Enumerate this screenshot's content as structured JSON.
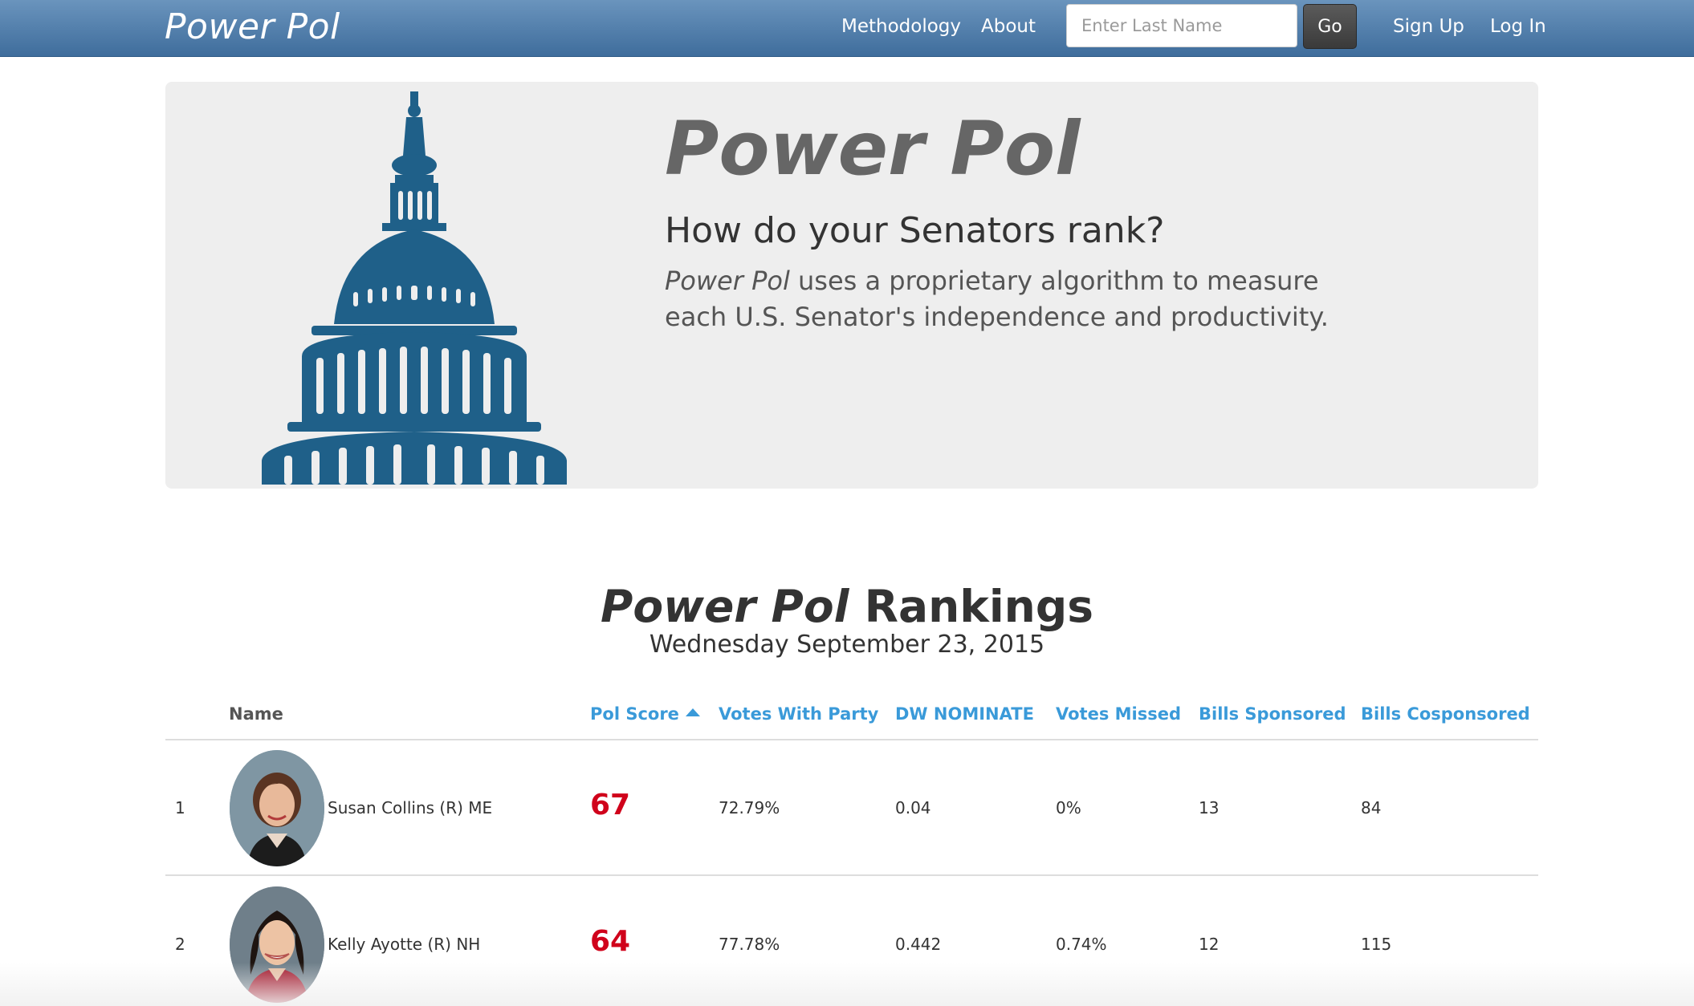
{
  "navbar": {
    "brand": "Power Pol",
    "links": [
      {
        "label": "Methodology"
      },
      {
        "label": "About"
      }
    ],
    "search": {
      "placeholder": "Enter Last Name",
      "value": ""
    },
    "go_label": "Go",
    "signup_label": "Sign Up",
    "login_label": "Log In"
  },
  "hero": {
    "title": "Power Pol",
    "subtitle": "How do your Senators rank?",
    "description_brand": "Power Pol",
    "description_rest": " uses a proprietary algorithm to measure each U.S. Senator's independence and productivity."
  },
  "rankings": {
    "title_brand": "Power Pol",
    "title_rest": " Rankings",
    "date": "Wednesday September 23, 2015",
    "columns": [
      {
        "label": "Name"
      },
      {
        "label": "Pol Score"
      },
      {
        "label": "Votes With Party"
      },
      {
        "label": "DW NOMINATE"
      },
      {
        "label": "Votes Missed"
      },
      {
        "label": "Bills Sponsored"
      },
      {
        "label": "Bills Cosponsored"
      }
    ],
    "sort_icon": "caret-up-icon",
    "rows": [
      {
        "rank": "1",
        "name": "Susan Collins (R) ME",
        "score": "67",
        "votes_with_party": "72.79%",
        "dw_nominate": "0.04",
        "votes_missed": "0%",
        "bills_sponsored": "13",
        "bills_cosponsored": "84"
      },
      {
        "rank": "2",
        "name": "Kelly Ayotte (R) NH",
        "score": "64",
        "votes_with_party": "77.78%",
        "dw_nominate": "0.442",
        "votes_missed": "0.74%",
        "bills_sponsored": "12",
        "bills_cosponsored": "115"
      }
    ]
  },
  "colors": {
    "navbar": "#4f7eaa",
    "capitol": "#1f6089",
    "score": "#d0021b",
    "sortable_header": "#3a9ad9"
  }
}
